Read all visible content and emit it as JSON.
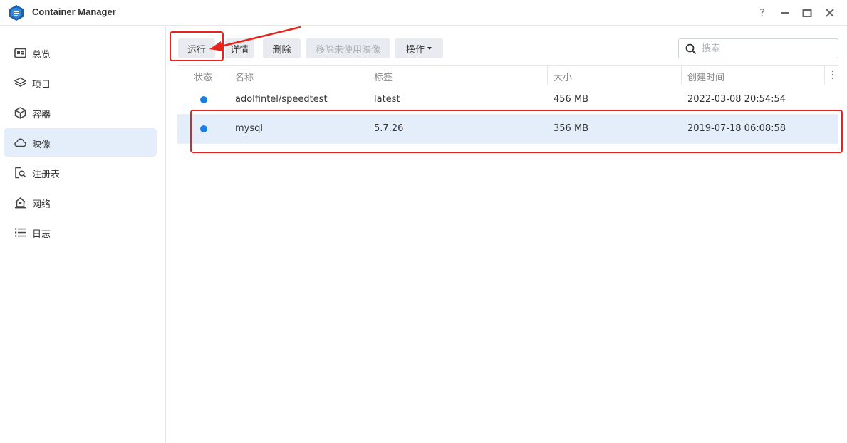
{
  "window": {
    "title": "Container Manager",
    "buttons": [
      "?",
      "minimize",
      "maximize",
      "close"
    ]
  },
  "sidebar": {
    "items": [
      {
        "label": "总览",
        "icon": "overview-icon",
        "active": false
      },
      {
        "label": "项目",
        "icon": "layers-icon",
        "active": false
      },
      {
        "label": "容器",
        "icon": "cube-icon",
        "active": false
      },
      {
        "label": "映像",
        "icon": "cloud-icon",
        "active": true
      },
      {
        "label": "注册表",
        "icon": "registry-search-icon",
        "active": false
      },
      {
        "label": "网络",
        "icon": "network-home-icon",
        "active": false
      },
      {
        "label": "日志",
        "icon": "list-icon",
        "active": false
      }
    ]
  },
  "toolbar": {
    "run_label": "运行",
    "details_label": "详情",
    "delete_label": "删除",
    "remove_unused_label": "移除未使用映像",
    "actions_label": "操作"
  },
  "search": {
    "placeholder": "搜索"
  },
  "table": {
    "headers": {
      "status": "状态",
      "name": "名称",
      "tag": "标签",
      "size": "大小",
      "created": "创建时间"
    },
    "rows": [
      {
        "name": "adolfintel/speedtest",
        "tag": "latest",
        "size": "456 MB",
        "created": "2022-03-08 20:54:54",
        "selected": false
      },
      {
        "name": "mysql",
        "tag": "5.7.26",
        "size": "356 MB",
        "created": "2019-07-18 06:08:58",
        "selected": true
      }
    ]
  },
  "colors": {
    "accent": "#1b7ee3",
    "selected_bg": "#e3eefa",
    "annotation": "#e8231c"
  }
}
